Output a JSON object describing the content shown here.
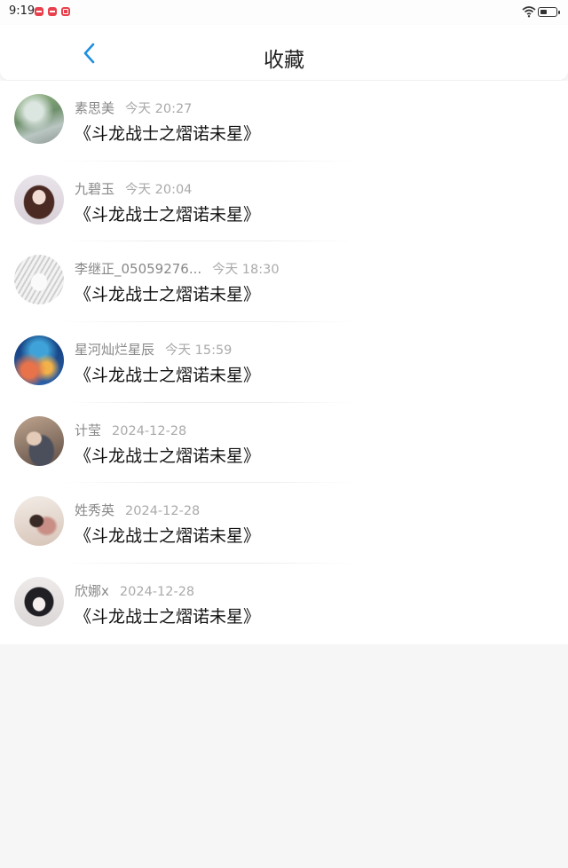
{
  "status_bar": {
    "time": "9:19"
  },
  "header": {
    "title": "收藏"
  },
  "favorites": [
    {
      "name": "素思美",
      "time": "今天 20:27",
      "title": "《斗龙战士之熠诺未星》",
      "avatar_icon": "street-photo-avatar",
      "avatar_colors": [
        "#8fb27f",
        "#c9d7cf"
      ]
    },
    {
      "name": "九碧玉",
      "time": "今天 20:04",
      "title": "《斗龙战士之熠诺未星》",
      "avatar_icon": "woman-portrait-avatar",
      "avatar_colors": [
        "#5a3a30",
        "#e8dde0"
      ]
    },
    {
      "name": "李继正_05059276...",
      "time": "今天 18:30",
      "title": "《斗龙战士之熠诺未星》",
      "avatar_icon": "anime-sketch-avatar",
      "avatar_colors": [
        "#d9d9d9",
        "#f4f4f4"
      ]
    },
    {
      "name": "星河灿烂星辰",
      "time": "今天 15:59",
      "title": "《斗龙战士之熠诺未星》",
      "avatar_icon": "galaxy-avatar",
      "avatar_colors": [
        "#1e4c8f",
        "#e8734a"
      ]
    },
    {
      "name": "计莹",
      "time": "2024-12-28",
      "title": "《斗龙战士之熠诺未星》",
      "avatar_icon": "person-photo-avatar",
      "avatar_colors": [
        "#6b5548",
        "#c7b6a8"
      ]
    },
    {
      "name": "姓秀英",
      "time": "2024-12-28",
      "title": "《斗龙战士之熠诺未星》",
      "avatar_icon": "woman-lying-avatar",
      "avatar_colors": [
        "#c8a093",
        "#efe6df"
      ]
    },
    {
      "name": "欣娜x",
      "time": "2024-12-28",
      "title": "《斗龙战士之熠诺未星》",
      "avatar_icon": "anime-girl-avatar",
      "avatar_colors": [
        "#2a2a2e",
        "#eceaea"
      ]
    }
  ],
  "colors": {
    "accent": "#1e8fe0",
    "notification": "#e8404c"
  }
}
